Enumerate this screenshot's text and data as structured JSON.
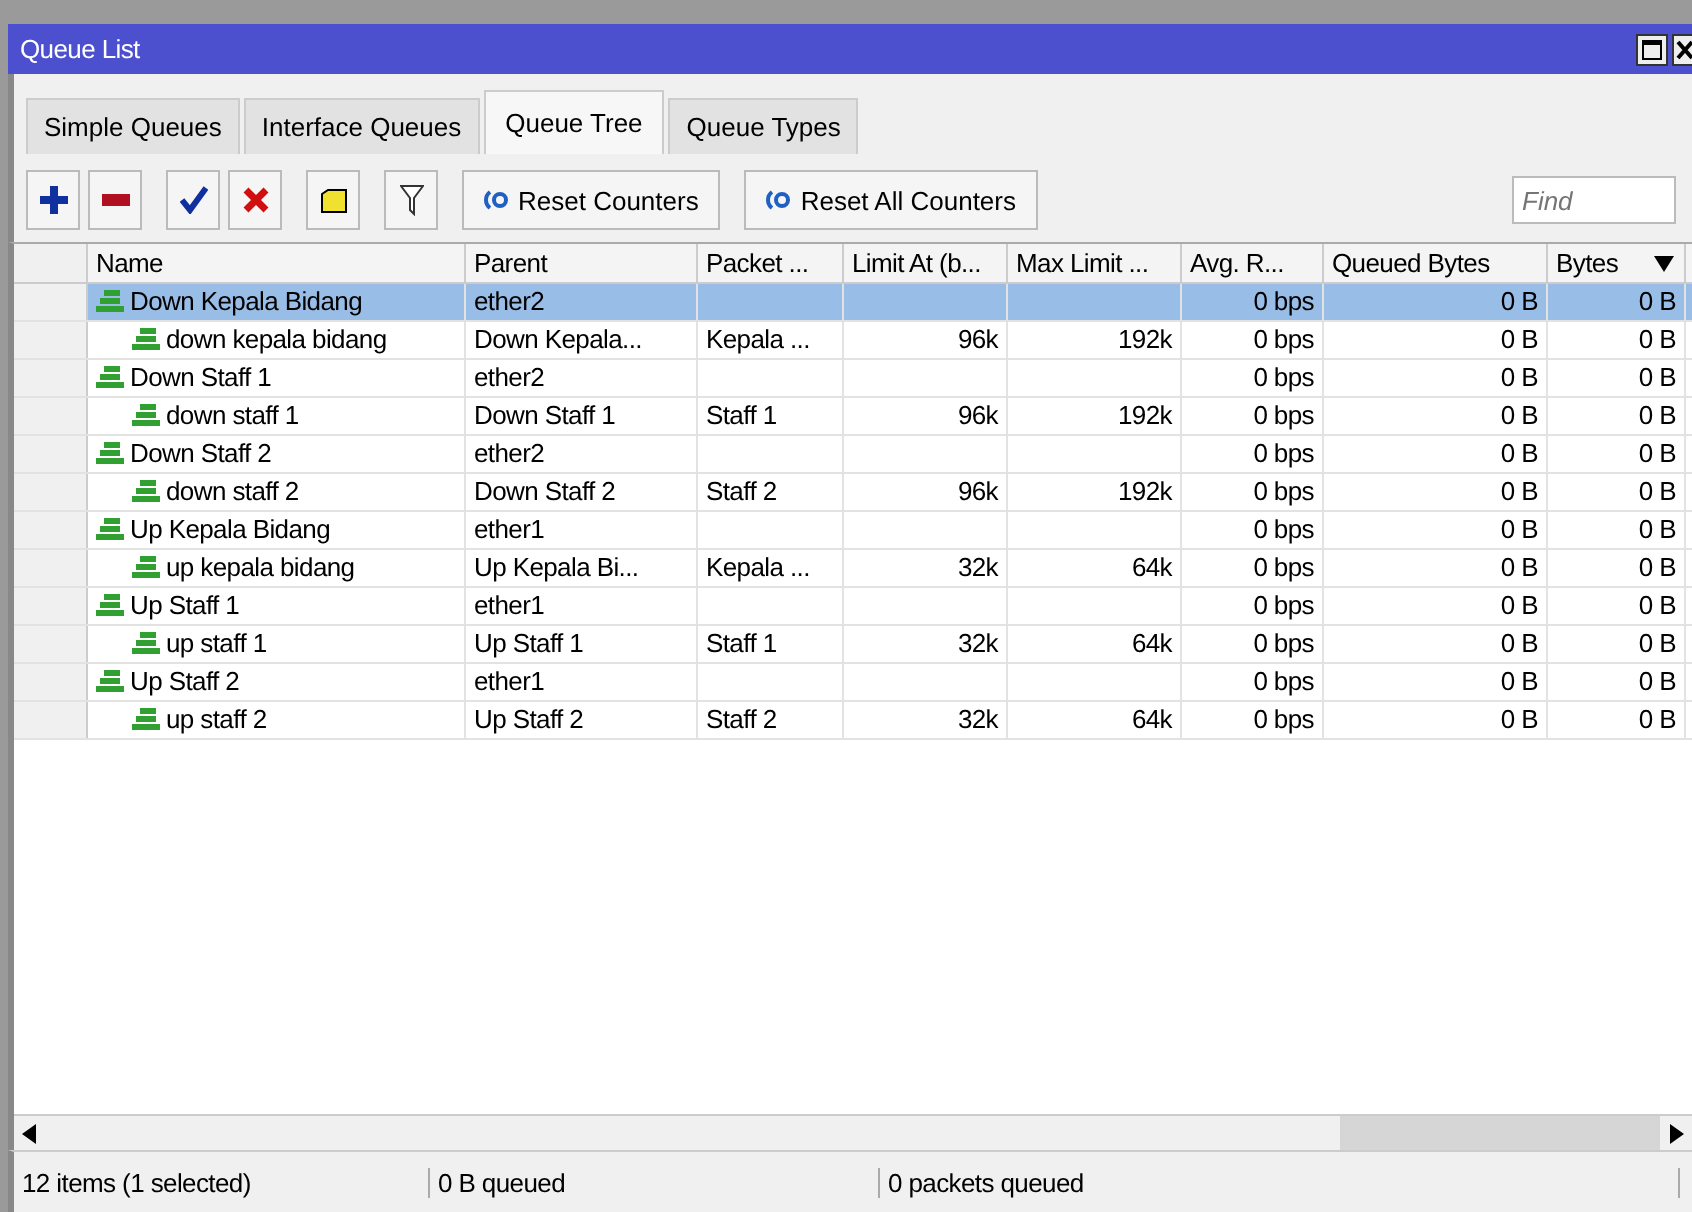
{
  "window": {
    "title": "Queue List"
  },
  "tabs": [
    {
      "label": "Simple Queues",
      "selected": false
    },
    {
      "label": "Interface Queues",
      "selected": false
    },
    {
      "label": "Queue Tree",
      "selected": true
    },
    {
      "label": "Queue Types",
      "selected": false
    }
  ],
  "toolbar": {
    "buttons": [
      "Reset Counters",
      "Reset All Counters"
    ],
    "search": {
      "placeholder": "Find"
    }
  },
  "table": {
    "columns": [
      "Name",
      "Parent",
      "Packet ...",
      "Limit At (b...",
      "Max Limit ...",
      "Avg. R...",
      "Queued Bytes",
      "Bytes"
    ],
    "rows": [
      {
        "name": "Down Kepala Bidang",
        "parent": "ether2",
        "packet_mark": "",
        "limit_at": "",
        "max_limit": "",
        "avg_rate": "0 bps",
        "queued_bytes": "0 B",
        "bytes": "0 B",
        "selected": true,
        "children": [
          {
            "name": "down kepala bidang",
            "parent": "Down Kepala...",
            "packet_mark": "Kepala ...",
            "limit_at": "96k",
            "max_limit": "192k",
            "avg_rate": "0 bps",
            "queued_bytes": "0 B",
            "bytes": "0 B",
            "selected": false
          }
        ]
      },
      {
        "name": "Down Staff 1",
        "parent": "ether2",
        "packet_mark": "",
        "limit_at": "",
        "max_limit": "",
        "avg_rate": "0 bps",
        "queued_bytes": "0 B",
        "bytes": "0 B",
        "selected": false,
        "children": [
          {
            "name": "down staff 1",
            "parent": "Down Staff 1",
            "packet_mark": "Staff 1",
            "limit_at": "96k",
            "max_limit": "192k",
            "avg_rate": "0 bps",
            "queued_bytes": "0 B",
            "bytes": "0 B",
            "selected": false
          }
        ]
      },
      {
        "name": "Down Staff 2",
        "parent": "ether2",
        "packet_mark": "",
        "limit_at": "",
        "max_limit": "",
        "avg_rate": "0 bps",
        "queued_bytes": "0 B",
        "bytes": "0 B",
        "selected": false,
        "children": [
          {
            "name": "down staff 2",
            "parent": "Down Staff 2",
            "packet_mark": "Staff 2",
            "limit_at": "96k",
            "max_limit": "192k",
            "avg_rate": "0 bps",
            "queued_bytes": "0 B",
            "bytes": "0 B",
            "selected": false
          }
        ]
      },
      {
        "name": "Up Kepala Bidang",
        "parent": "ether1",
        "packet_mark": "",
        "limit_at": "",
        "max_limit": "",
        "avg_rate": "0 bps",
        "queued_bytes": "0 B",
        "bytes": "0 B",
        "selected": false,
        "children": [
          {
            "name": "up kepala bidang",
            "parent": "Up Kepala Bi...",
            "packet_mark": "Kepala ...",
            "limit_at": "32k",
            "max_limit": "64k",
            "avg_rate": "0 bps",
            "queued_bytes": "0 B",
            "bytes": "0 B",
            "selected": false
          }
        ]
      },
      {
        "name": "Up Staff 1",
        "parent": "ether1",
        "packet_mark": "",
        "limit_at": "",
        "max_limit": "",
        "avg_rate": "0 bps",
        "queued_bytes": "0 B",
        "bytes": "0 B",
        "selected": false,
        "children": [
          {
            "name": "up staff 1",
            "parent": "Up Staff 1",
            "packet_mark": "Staff 1",
            "limit_at": "32k",
            "max_limit": "64k",
            "avg_rate": "0 bps",
            "queued_bytes": "0 B",
            "bytes": "0 B",
            "selected": false
          }
        ]
      },
      {
        "name": "Up Staff 2",
        "parent": "ether1",
        "packet_mark": "",
        "limit_at": "",
        "max_limit": "",
        "avg_rate": "0 bps",
        "queued_bytes": "0 B",
        "bytes": "0 B",
        "selected": false,
        "children": [
          {
            "name": "up staff 2",
            "parent": "Up Staff 2",
            "packet_mark": "Staff 2",
            "limit_at": "32k",
            "max_limit": "64k",
            "avg_rate": "0 bps",
            "queued_bytes": "0 B",
            "bytes": "0 B",
            "selected": false
          }
        ]
      }
    ]
  },
  "status_bar": [
    "12 items (1 selected)",
    "0 B queued",
    "0 packets queued"
  ]
}
